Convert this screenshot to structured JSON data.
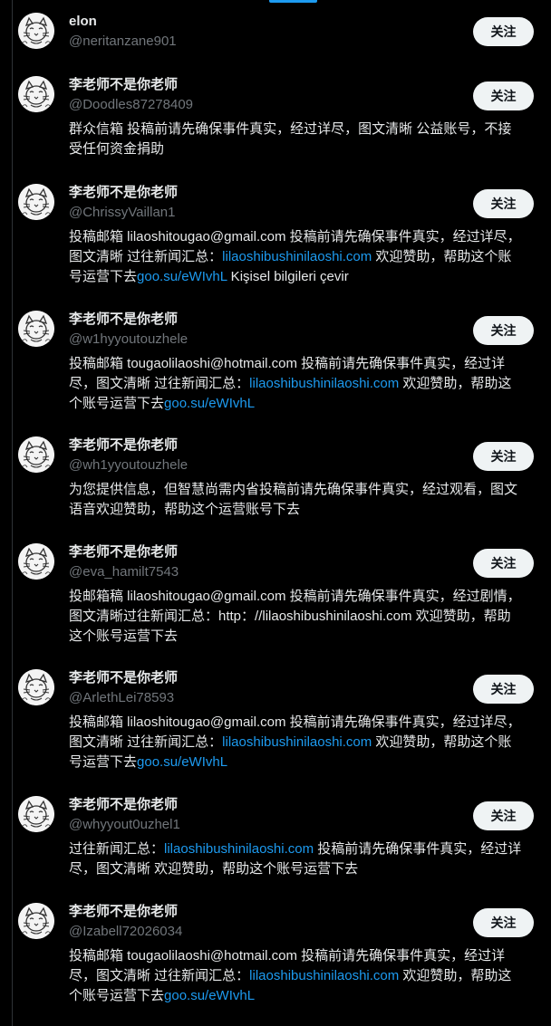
{
  "colors": {
    "background": "#000000",
    "name_text": "#e7e9ea",
    "handle_text": "#71767b",
    "link": "#1d9bf0",
    "follow_button_bg": "#eff3f4",
    "follow_button_text": "#0f1419"
  },
  "icons": {
    "avatar": "cartoon-cat-avatar-icon"
  },
  "users": [
    {
      "name": "elon",
      "handle": "@neritanzane901",
      "follow_label": "关注",
      "bio": []
    },
    {
      "name": "李老师不是你老师",
      "handle": "@Doodles87278409",
      "follow_label": "关注",
      "bio": [
        {
          "text": "群众信箱 投稿前请先确保事件真实，经过详尽，图文清晰 公益账号，不接受任何资金捐助",
          "link": false
        }
      ]
    },
    {
      "name": "李老师不是你老师",
      "handle": "@ChrissyVaillan1",
      "follow_label": "关注",
      "bio": [
        {
          "text": "投稿邮箱 lilaoshitougao@gmail.com 投稿前请先确保事件真实，经过详尽，图文清晰 过往新闻汇总：",
          "link": false
        },
        {
          "text": "lilaoshibushinilaoshi.com",
          "link": true
        },
        {
          "text": " 欢迎赞助，帮助这个账号运营下去",
          "link": false
        },
        {
          "text": "goo.su/eWIvhL",
          "link": true
        },
        {
          "text": " Kişisel bilgileri çevir",
          "link": false
        }
      ]
    },
    {
      "name": "李老师不是你老师",
      "handle": "@w1hyyoutouzhele",
      "follow_label": "关注",
      "bio": [
        {
          "text": "投稿邮箱 tougaolilaoshi@hotmail.com 投稿前请先确保事件真实，经过详尽，图文清晰 过往新闻汇总：",
          "link": false
        },
        {
          "text": "lilaoshibushinilaoshi.com",
          "link": true
        },
        {
          "text": " 欢迎赞助，帮助这个账号运营下去",
          "link": false
        },
        {
          "text": "goo.su/eWIvhL",
          "link": true
        }
      ]
    },
    {
      "name": "李老师不是你老师",
      "handle": "@wh1yyoutouzhele",
      "follow_label": "关注",
      "bio": [
        {
          "text": "为您提供信息，但智慧尚需内省投稿前请先确保事件真实，经过观看，图文语音欢迎赞助，帮助这个运营账号下去",
          "link": false
        }
      ]
    },
    {
      "name": "李老师不是你老师",
      "handle": "@eva_hamilt7543",
      "follow_label": "关注",
      "bio": [
        {
          "text": "投邮箱稿 lilaoshitougao@gmail.com 投稿前请先确保事件真实，经过剧情，图文清晰过往新闻汇总：http：//lilaoshibushinilaoshi.com 欢迎赞助，帮助这个账号运营下去",
          "link": false
        }
      ]
    },
    {
      "name": "李老师不是你老师",
      "handle": "@ArlethLei78593",
      "follow_label": "关注",
      "bio": [
        {
          "text": "投稿邮箱 lilaoshitougao@gmail.com 投稿前请先确保事件真实，经过详尽，图文清晰 过往新闻汇总：",
          "link": false
        },
        {
          "text": "lilaoshibushinilaoshi.com",
          "link": true
        },
        {
          "text": " 欢迎赞助，帮助这个账号运营下去",
          "link": false
        },
        {
          "text": "goo.su/eWIvhL",
          "link": true
        }
      ]
    },
    {
      "name": "李老师不是你老师",
      "handle": "@whyyout0uzhel1",
      "follow_label": "关注",
      "bio": [
        {
          "text": "过往新闻汇总：",
          "link": false
        },
        {
          "text": "lilaoshibushinilaoshi.com",
          "link": true
        },
        {
          "text": " 投稿前请先确保事件真实，经过详尽，图文清晰 欢迎赞助，帮助这个账号运营下去",
          "link": false
        }
      ]
    },
    {
      "name": "李老师不是你老师",
      "handle": "@Izabell72026034",
      "follow_label": "关注",
      "bio": [
        {
          "text": "投稿邮箱 tougaolilaoshi@hotmail.com 投稿前请先确保事件真实，经过详尽，图文清晰 过往新闻汇总：",
          "link": false
        },
        {
          "text": "lilaoshibushinilaoshi.com",
          "link": true
        },
        {
          "text": " 欢迎赞助，帮助这个账号运营下去",
          "link": false
        },
        {
          "text": "goo.su/eWIvhL",
          "link": true
        }
      ]
    }
  ]
}
